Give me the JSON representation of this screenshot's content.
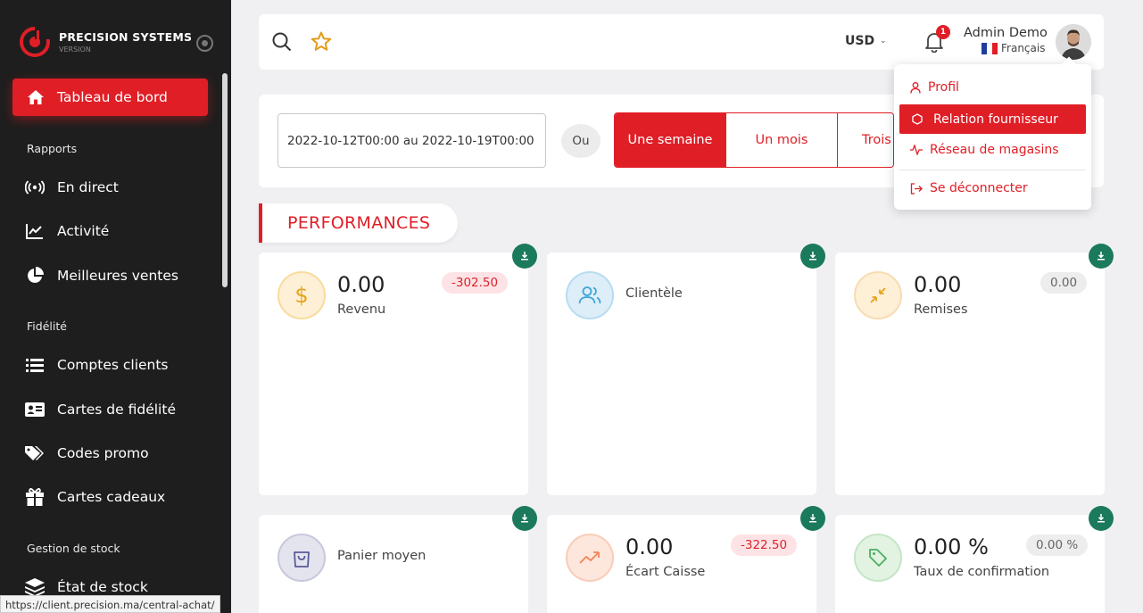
{
  "brand": {
    "name": "PRECISION SYSTEMS",
    "subtitle": "VERSION"
  },
  "sidebar": {
    "active": {
      "label": "Tableau de bord",
      "icon": "home-icon"
    },
    "sections": [
      {
        "title": "Rapports",
        "items": [
          {
            "label": "En direct",
            "icon": "broadcast-icon"
          },
          {
            "label": "Activité",
            "icon": "line-chart-icon"
          },
          {
            "label": "Meilleures ventes",
            "icon": "pie-chart-icon"
          }
        ]
      },
      {
        "title": "Fidélité",
        "items": [
          {
            "label": "Comptes clients",
            "icon": "list-icon"
          },
          {
            "label": "Cartes de fidélité",
            "icon": "id-card-icon"
          },
          {
            "label": "Codes promo",
            "icon": "tags-icon"
          },
          {
            "label": "Cartes cadeaux",
            "icon": "gift-icon"
          }
        ]
      },
      {
        "title": "Gestion de stock",
        "items": [
          {
            "label": "État de stock",
            "icon": "layers-icon"
          }
        ]
      }
    ]
  },
  "status_url": "https://client.precision.ma/central-achat/",
  "topbar": {
    "currency": "USD",
    "notifications_count": "1",
    "user_name": "Admin Demo",
    "language": "Français"
  },
  "user_menu": {
    "items": [
      {
        "label": "Profil",
        "icon": "user-icon"
      },
      {
        "label": "Relation fournisseur",
        "icon": "hexagon-icon"
      },
      {
        "label": "Réseau de magasins",
        "icon": "activity-icon"
      },
      {
        "label": "Se déconnecter",
        "icon": "logout-icon"
      }
    ]
  },
  "filter": {
    "date_range": "2022-10-12T00:00 au 2022-10-19T00:00",
    "or_label": "Ou",
    "periods": [
      "Une semaine",
      "Un mois",
      "Trois"
    ]
  },
  "section_title": "PERFORMANCES",
  "cards": [
    {
      "value": "0.00",
      "label": "Revenu",
      "badge": "-302.50",
      "badge_type": "neg",
      "icon": "dollar-icon",
      "color": "#f2a91e"
    },
    {
      "value": "",
      "label": "Clientèle",
      "badge": "",
      "icon": "users-icon",
      "color": "#3ea6d8"
    },
    {
      "value": "0.00",
      "label": "Remises",
      "badge": "0.00",
      "badge_type": "neu",
      "icon": "shrink-arrows-icon",
      "color": "#f2a91e"
    },
    {
      "value": "",
      "label": "Panier moyen",
      "badge": "",
      "icon": "shopping-bag-icon",
      "color": "#5a5a9a"
    },
    {
      "value": "0.00",
      "label": "Écart Caisse",
      "badge": "-322.50",
      "badge_type": "neg",
      "icon": "trending-up-icon",
      "color": "#f2855a"
    },
    {
      "value": "0.00 %",
      "label": "Taux de confirmation",
      "badge": "0.00 %",
      "badge_type": "neu",
      "icon": "tag-icon",
      "color": "#4caf60"
    }
  ],
  "colors": {
    "primary": "#e01e26",
    "sidebar_bg": "#1e1e1e",
    "download": "#1b7a5b"
  }
}
